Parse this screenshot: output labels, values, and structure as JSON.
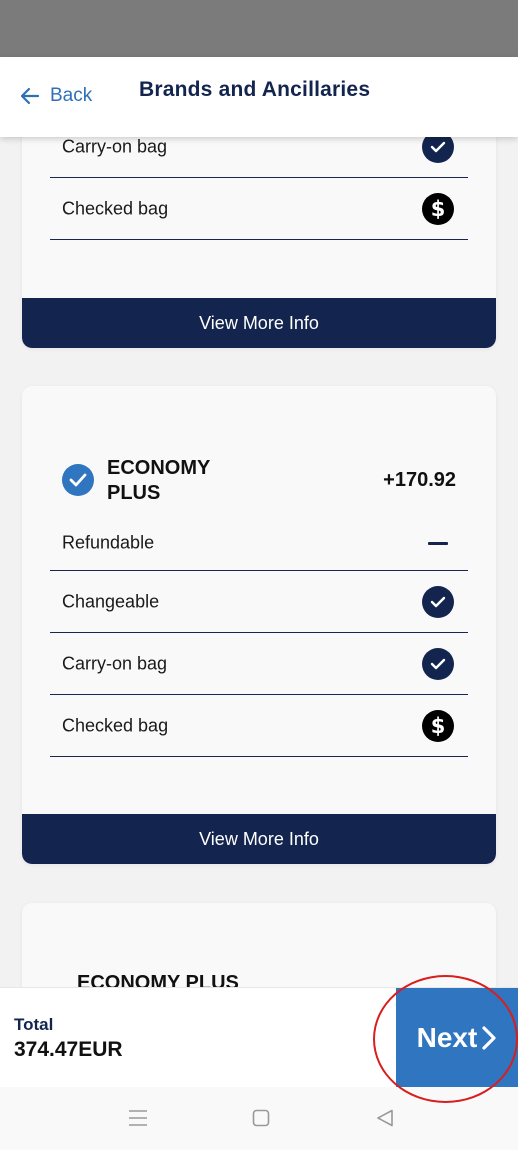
{
  "header": {
    "back_label": "Back",
    "title": "Brands and Ancillaries"
  },
  "cards": [
    {
      "rows": [
        {
          "label": "Carry-on bag",
          "status": "included"
        },
        {
          "label": "Checked bag",
          "status": "paid"
        }
      ],
      "more_label": "View More Info"
    },
    {
      "name": "ECONOMY PLUS",
      "price": "+170.92",
      "selected": true,
      "rows": [
        {
          "label": "Refundable",
          "status": "not-included"
        },
        {
          "label": "Changeable",
          "status": "included"
        },
        {
          "label": "Carry-on bag",
          "status": "included"
        },
        {
          "label": "Checked bag",
          "status": "paid"
        }
      ],
      "more_label": "View More Info"
    },
    {
      "name": "ECONOMY PLUS"
    }
  ],
  "footer": {
    "total_label": "Total",
    "total_value": "374.47EUR",
    "next_label": "Next"
  },
  "colors": {
    "navy": "#13254f",
    "accent_blue": "#2f75c0",
    "highlight": "#d81e1e"
  },
  "icons": [
    "arrow-left-icon",
    "check-circle-icon",
    "dollar-circle-icon",
    "minus-icon",
    "chevron-right-icon",
    "menu-nav-icon",
    "home-nav-icon",
    "back-nav-icon"
  ]
}
